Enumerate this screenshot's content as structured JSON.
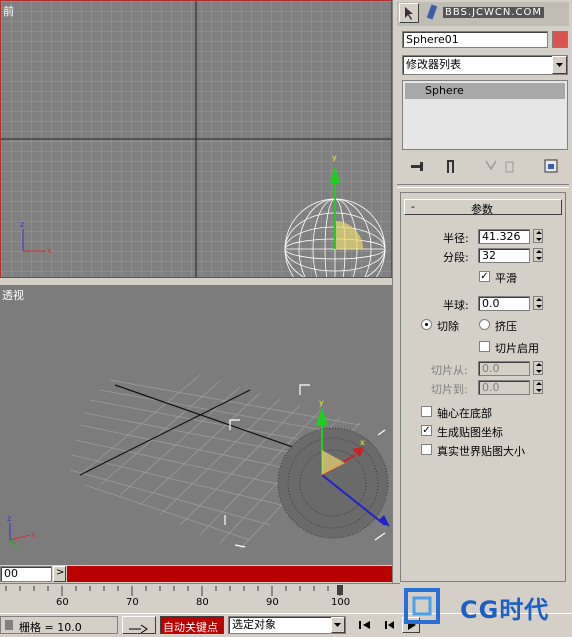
{
  "viewports": {
    "top": {
      "label": "前"
    },
    "bottom": {
      "label": "透视"
    }
  },
  "panel": {
    "brand": "BBS.JCWCN.COM",
    "object_name": "Sphere01",
    "object_color": "#d9534f",
    "modifier_list": "修改器列表",
    "stack_item": "Sphere",
    "rollout": {
      "collapse": "-",
      "title": "参数"
    },
    "params": {
      "radius_label": "半径:",
      "radius_value": "41.326",
      "segments_label": "分段:",
      "segments_value": "32",
      "smooth_label": "平滑",
      "smooth_checked": "✓",
      "hemisphere_label": "半球:",
      "hemisphere_value": "0.0",
      "chop_label": "切除",
      "squash_label": "挤压",
      "slice_on_label": "切片启用",
      "slice_from_label": "切片从:",
      "slice_from_value": "0.0",
      "slice_to_label": "切片到:",
      "slice_to_value": "0.0",
      "base_to_pivot_label": "轴心在底部",
      "gen_map_label": "生成贴图坐标",
      "gen_map_checked": "✓",
      "real_world_label": "真实世界贴图大小"
    }
  },
  "timeline": {
    "frame_field": "00",
    "arrow": ">",
    "ticks": [
      "60",
      "70",
      "80",
      "90",
      "100"
    ]
  },
  "statusbar": {
    "grid_label": "栅格 = 10.0",
    "autokey_label": "自动关键点",
    "selection_label": "选定对象"
  },
  "watermark": {
    "text": "CG时代"
  }
}
